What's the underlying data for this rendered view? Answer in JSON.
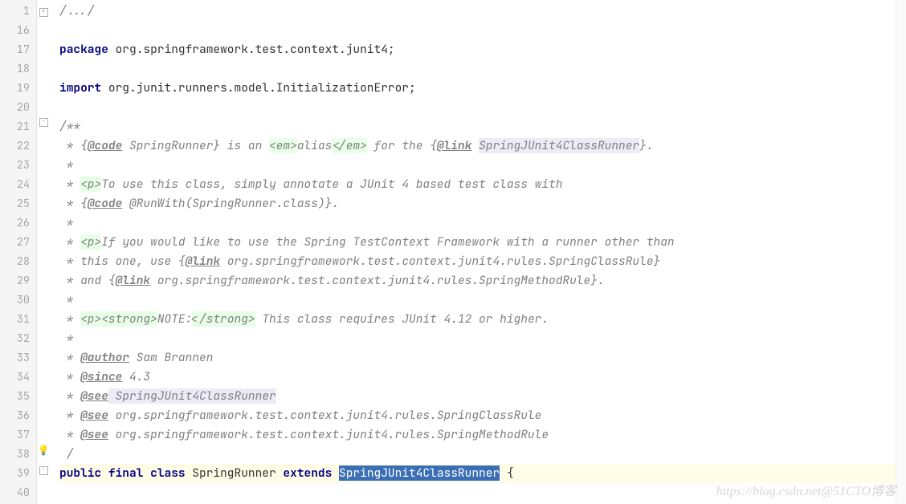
{
  "line_numbers": [
    "1",
    "16",
    "17",
    "18",
    "19",
    "20",
    "21",
    "22",
    "23",
    "24",
    "25",
    "26",
    "27",
    "28",
    "29",
    "30",
    "31",
    "32",
    "33",
    "34",
    "35",
    "36",
    "37",
    "38",
    "39",
    "40"
  ],
  "fold_collapsed_marker": "+",
  "fold_open_marker": "−",
  "code": {
    "l0": "/.../",
    "kw_package": "package",
    "pkg_name": " org.springframework.test.context.junit4;",
    "kw_import": "import",
    "import_name": " org.junit.runners.model.InitializationError;",
    "doc_open": "/**",
    "doc_star": " * ",
    "brace_open": "{",
    "brace_close": "}",
    "doc_code": "@code",
    "l22a": " SpringRunner",
    "l22_is": " is an ",
    "tag_em_o": "<em>",
    "l22_alias": "alias",
    "tag_em_c": "</em>",
    "l22_for": " for the ",
    "doc_link": "@link",
    "sp": " ",
    "l22_runner": "SpringJUnit4ClassRunner",
    "dot": ".",
    "tag_p": "<p>",
    "l24": "To use this class, simply annotate a JUnit 4 based test class with",
    "l25a": " @RunWith(SpringRunner.class)",
    "l27": "If you would like to use the Spring TestContext Framework with a runner other than",
    "l28a": "this one, use ",
    "l28b": " org.springframework.test.context.junit4.rules.SpringClassRule",
    "l29a": "and ",
    "l29b": " org.springframework.test.context.junit4.rules.SpringMethodRule",
    "tag_strong_o": "<strong>",
    "l31_note": "NOTE:",
    "tag_strong_c": "</strong>",
    "l31_rest": " This class requires JUnit 4.12 or higher.",
    "doc_author": "@author",
    "l33": " Sam Brannen",
    "doc_since": "@since",
    "l34": " 4.3",
    "doc_see": "@see",
    "l35": " SpringJUnit4ClassRunner",
    "l36": " org.springframework.test.context.junit4.rules.SpringClassRule",
    "l37": " org.springframework.test.context.junit4.rules.SpringMethodRule",
    "l38": "/",
    "kw_public": "public",
    "kw_final": "final",
    "kw_class": "class",
    "l39_name": " SpringRunner ",
    "kw_extends": "extends",
    "l39_super": "SpringJUnit4ClassRunner",
    "l39_end": " {"
  },
  "watermark": "https://blog.csdn.net@51CTO博客"
}
